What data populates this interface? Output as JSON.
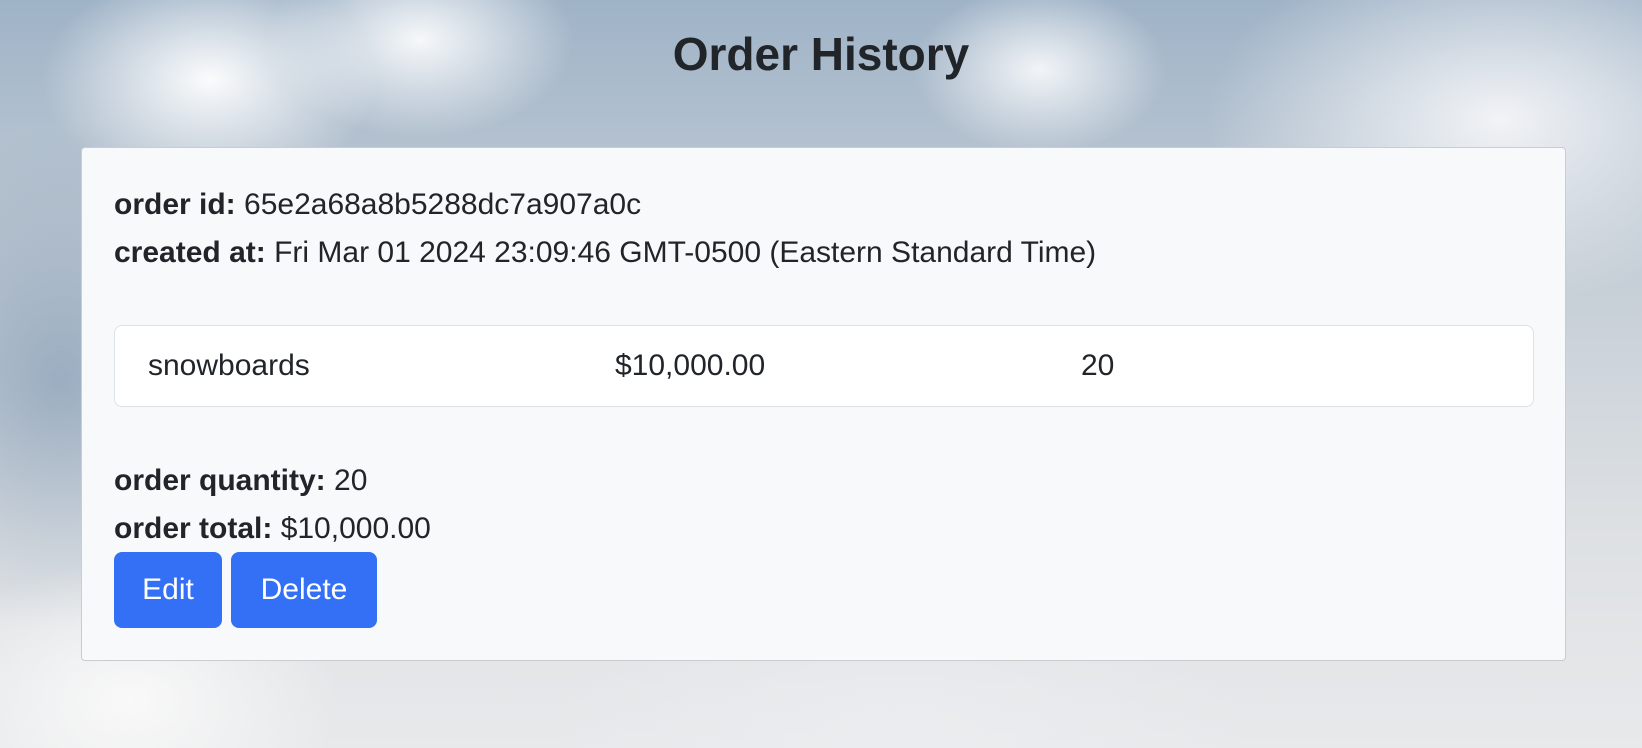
{
  "page": {
    "title": "Order History"
  },
  "order": {
    "id_label": "order id:",
    "id_value": "65e2a68a8b5288dc7a907a0c",
    "created_label": "created at:",
    "created_value": "Fri Mar 01 2024 23:09:46 GMT-0500 (Eastern Standard Time)",
    "items": [
      {
        "name": "snowboards",
        "price": "$10,000.00",
        "quantity": "20"
      }
    ],
    "quantity_label": "order quantity:",
    "quantity_value": "20",
    "total_label": "order total:",
    "total_value": "$10,000.00",
    "actions": {
      "edit_label": "Edit",
      "delete_label": "Delete"
    }
  },
  "colors": {
    "button_primary": "#3470f5",
    "card_background": "#f8f9fa",
    "text": "#212529"
  }
}
